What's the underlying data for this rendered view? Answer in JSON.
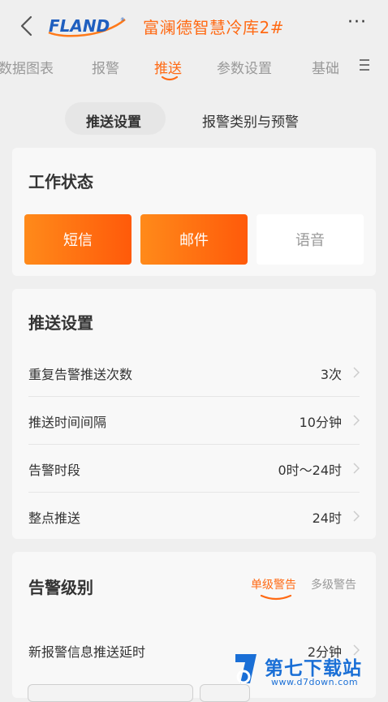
{
  "header": {
    "back_icon": "chevron-left-icon",
    "logo_text": "FLAND",
    "title": "富澜德智慧冷库2#",
    "more_label": "···"
  },
  "tabs": [
    {
      "label": "数据图表",
      "active": false
    },
    {
      "label": "报警",
      "active": false
    },
    {
      "label": "推送",
      "active": true
    },
    {
      "label": "参数设置",
      "active": false
    },
    {
      "label": "基础",
      "active": false
    }
  ],
  "subtabs": [
    {
      "label": "推送设置",
      "active": true
    },
    {
      "label": "报警类别与预警",
      "active": false
    }
  ],
  "work_status": {
    "title": "工作状态",
    "buttons": [
      {
        "label": "短信",
        "enabled": true
      },
      {
        "label": "邮件",
        "enabled": true
      },
      {
        "label": "语音",
        "enabled": false
      }
    ]
  },
  "push_settings": {
    "title": "推送设置",
    "rows": [
      {
        "label": "重复告警推送次数",
        "value": "3次"
      },
      {
        "label": "推送时间间隔",
        "value": "10分钟"
      },
      {
        "label": "告警时段",
        "value": "0时～24时"
      },
      {
        "label": "整点推送",
        "value": "24时"
      }
    ]
  },
  "alarm_level": {
    "title": "告警级别",
    "tabs": [
      {
        "label": "单级警告",
        "active": true
      },
      {
        "label": "多级警告",
        "active": false
      }
    ],
    "rows": [
      {
        "label": "新报警信息推送延时",
        "value": "2分钟"
      }
    ]
  },
  "watermark": {
    "brand": "第七下载站",
    "url": "www.d7down.com"
  },
  "colors": {
    "accent": "#ff6a14",
    "background": "#efefef",
    "card": "#f8f8f8",
    "watermark_blue": "#1a6fd6"
  }
}
